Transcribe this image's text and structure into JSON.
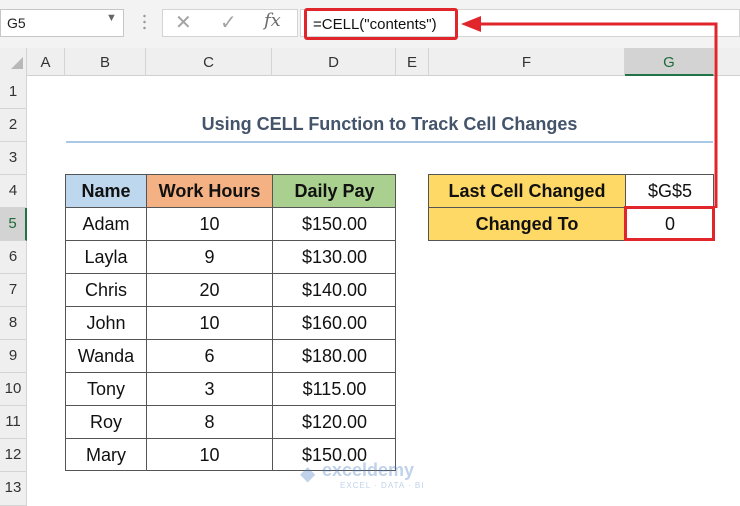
{
  "namebox": {
    "value": "G5"
  },
  "formula_bar": {
    "cancel_glyph": "✕",
    "enter_glyph": "✓",
    "fx_label": "fx",
    "formula": "=CELL(\"contents\")"
  },
  "columns": [
    "A",
    "B",
    "C",
    "D",
    "E",
    "F",
    "G"
  ],
  "rows": [
    "1",
    "2",
    "3",
    "4",
    "5",
    "6",
    "7",
    "8",
    "9",
    "10",
    "11",
    "12",
    "13"
  ],
  "selected_column": "G",
  "selected_row": "5",
  "title": "Using CELL Function to Track Cell Changes",
  "table": {
    "headers": [
      "Name",
      "Work Hours",
      "Daily Pay"
    ],
    "rows": [
      [
        "Adam",
        "10",
        "$150.00"
      ],
      [
        "Layla",
        "9",
        "$130.00"
      ],
      [
        "Chris",
        "20",
        "$140.00"
      ],
      [
        "John",
        "10",
        "$160.00"
      ],
      [
        "Wanda",
        "6",
        "$180.00"
      ],
      [
        "Tony",
        "3",
        "$115.00"
      ],
      [
        "Roy",
        "8",
        "$120.00"
      ],
      [
        "Mary",
        "10",
        "$150.00"
      ]
    ]
  },
  "tracker": {
    "last_cell_label": "Last Cell Changed",
    "last_cell_value": "$G$5",
    "changed_to_label": "Changed To",
    "changed_to_value": "0"
  },
  "watermark": {
    "brand": "exceldemy",
    "tagline": "EXCEL · DATA · BI"
  },
  "colors": {
    "highlight": "#e0262b",
    "name_header": "#bdd7ee",
    "hours_header": "#f4b183",
    "pay_header": "#a9d08e",
    "tracker_label": "#ffd966"
  }
}
